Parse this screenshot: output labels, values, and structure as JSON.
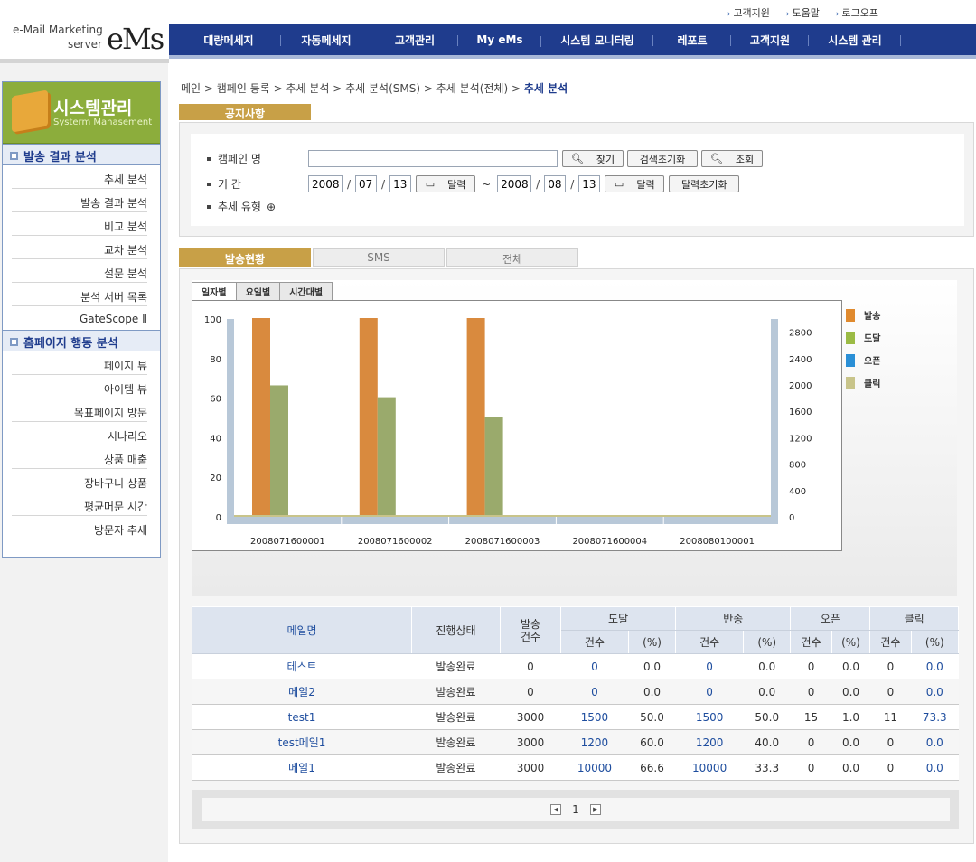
{
  "toplinks": [
    "고객지원",
    "도움말",
    "로그오프"
  ],
  "logo": {
    "line1": "e-Mail Marketing",
    "line2": "server",
    "brand": "eMs"
  },
  "nav": [
    "대량메세지",
    "자동메세지",
    "고객관리",
    "My eMs",
    "시스템 모니터링",
    "레포트",
    "고객지원",
    "시스템 관리"
  ],
  "sidebar": {
    "title": "시스템관리",
    "subtitle": "Systerm Manasement",
    "sections": [
      {
        "title": "발송 결과 분석",
        "items": [
          "추세 분석",
          "발송 결과 분석",
          "비교 분석",
          "교차 분석",
          "설문 분석",
          "분석 서버 목록",
          "GateScope Ⅱ"
        ]
      },
      {
        "title": "홈페이지 행동 분석",
        "items": [
          "페이지 뷰",
          "아이템 뷰",
          "목표페이지 방문",
          "시나리오",
          "상품 매출",
          "장바구니 상품",
          "평균머문 시간",
          "방문자 추세"
        ]
      }
    ]
  },
  "breadcrumb": {
    "path": "메인 > 캠페인 등록 > 추세 분석 > 추세 분석(SMS) > 추세 분석(전체) > ",
    "current": "추세 분석",
    "home": "메인"
  },
  "notice_tab": "공지사항",
  "search": {
    "campaign_label": "캠페인 명",
    "campaign_value": "",
    "find_btn": "찾기",
    "reset_btn": "검색초기화",
    "query_btn": "조회",
    "period_label": "기 간",
    "from": {
      "y": "2008",
      "m": "07",
      "d": "13"
    },
    "to": {
      "y": "2008",
      "m": "08",
      "d": "13"
    },
    "calendar_btn": "달력",
    "calendar_reset_btn": "달력초기화",
    "type_label": "추세 유형",
    "tilde": "~"
  },
  "main_tabs": [
    "발송현황",
    "SMS",
    "전체"
  ],
  "chart_tabs": [
    "일자별",
    "요일별",
    "시간대별"
  ],
  "legend": [
    {
      "name": "발송",
      "color": "#e08a2e"
    },
    {
      "name": "도달",
      "color": "#9bbb45"
    },
    {
      "name": "오픈",
      "color": "#2a8fd6"
    },
    {
      "name": "클릭",
      "color": "#c8c48a"
    }
  ],
  "chart_data": {
    "type": "bar",
    "categories": [
      "2008071600001",
      "2008071600002",
      "2008071600003",
      "2008071600004",
      "2008080100001"
    ],
    "series": [
      {
        "name": "발송",
        "values": [
          100,
          100,
          100,
          0,
          0
        ],
        "color": "#d98a3e"
      },
      {
        "name": "도달",
        "values": [
          66,
          60,
          50,
          0,
          0
        ],
        "color": "#9aaa6c"
      }
    ],
    "ylim": [
      0,
      100
    ],
    "yticks": [
      0,
      20,
      40,
      60,
      80,
      100
    ],
    "y2ticks": [
      0,
      400,
      800,
      1200,
      1600,
      2000,
      2400,
      2800
    ],
    "y2lim": [
      0,
      3000
    ]
  },
  "table": {
    "headers": {
      "name": "메일명",
      "status": "진행상태",
      "sent": "발송\n건수",
      "reach": "도달",
      "bounce": "반송",
      "open": "오픈",
      "click": "클릭",
      "count": "건수",
      "pct": "(%)"
    },
    "rows": [
      [
        "테스트",
        "발송완료",
        "0",
        "0",
        "0.0",
        "0",
        "0.0",
        "0",
        "0.0",
        "0",
        "0.0"
      ],
      [
        "메일2",
        "발송완료",
        "0",
        "0",
        "0.0",
        "0",
        "0.0",
        "0",
        "0.0",
        "0",
        "0.0"
      ],
      [
        "test1",
        "발송완료",
        "3000",
        "1500",
        "50.0",
        "1500",
        "50.0",
        "15",
        "1.0",
        "11",
        "73.3"
      ],
      [
        "test메일1",
        "발송완료",
        "3000",
        "1200",
        "60.0",
        "1200",
        "40.0",
        "0",
        "0.0",
        "0",
        "0.0"
      ],
      [
        "메일1",
        "발송완료",
        "3000",
        "10000",
        "66.6",
        "10000",
        "33.3",
        "0",
        "0.0",
        "0",
        "0.0"
      ]
    ]
  },
  "pager": {
    "page": "1"
  }
}
